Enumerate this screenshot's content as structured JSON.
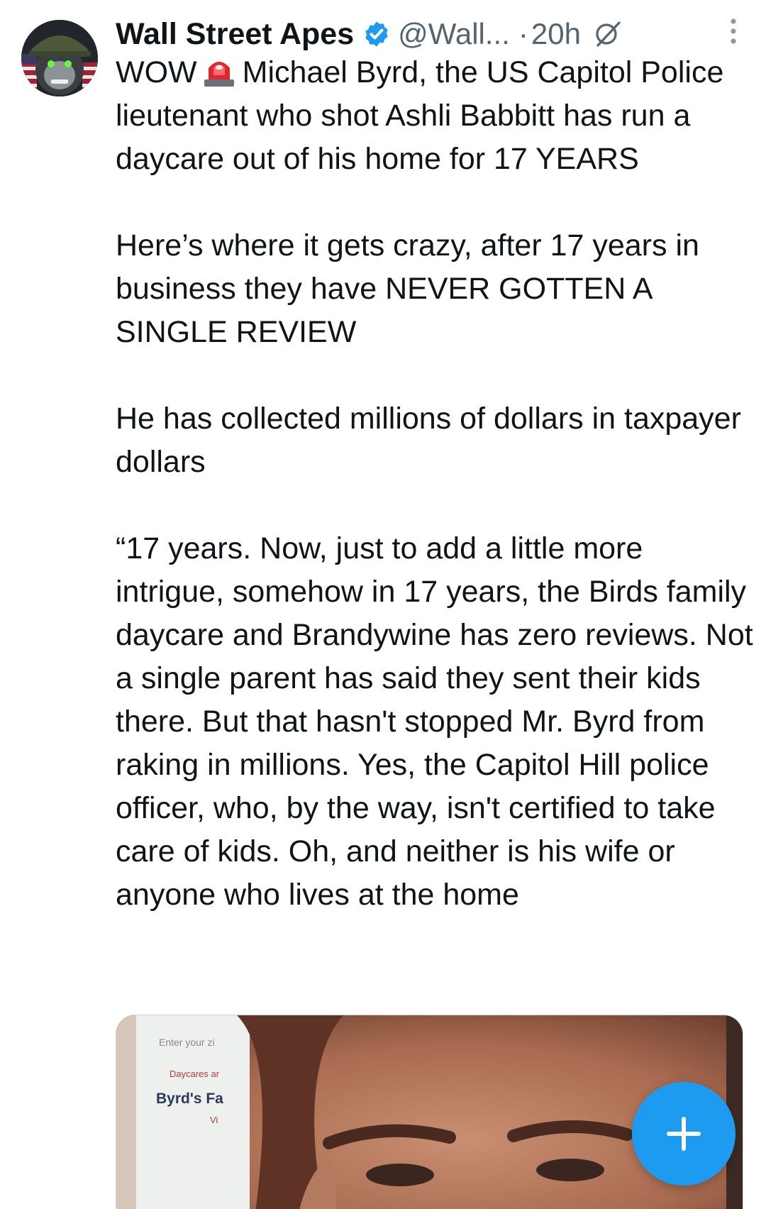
{
  "tweet": {
    "author": {
      "display_name": "Wall Street Apes",
      "handle": "@Wall...",
      "verified": true,
      "avatar_icon": "gorilla-soldier-avatar"
    },
    "separator": "·",
    "time": "20h",
    "icons": {
      "verified": "verified-badge-icon",
      "reply_restricted": "circle-slash-icon",
      "more": "more-vertical-icon",
      "siren": "police-siren-emoji"
    },
    "body": {
      "p1_lead": "WOW",
      "p1_rest": "Michael Byrd, the US Capitol Police lieutenant who shot Ashli Babbitt has run a daycare out of his home for 17 YEARS",
      "p2": "Here’s where it gets crazy, after 17 years in business they have NEVER GOTTEN A SINGLE REVIEW",
      "p3": "He has collected millions of dollars in taxpayer dollars",
      "p4": "“17 years. Now, just to add a little more intrigue, somehow in 17 years, the Birds family daycare and Brandywine has zero reviews. Not a single parent has said they sent their kids there. But that hasn't stopped Mr. Byrd from raking in millions. Yes, the Capitol Hill police officer, who, by the way, isn't certified to take care of kids. Oh, and neither is his wife or anyone who lives at the home"
    },
    "media": {
      "overlay_lines": [
        "Enter your zi",
        "Daycares ar",
        "Byrd's Fa",
        "Vi"
      ]
    }
  },
  "fab": {
    "icon": "plus-icon"
  },
  "colors": {
    "text": "#0f1419",
    "secondary": "#536471",
    "accent": "#1d9bf0"
  }
}
